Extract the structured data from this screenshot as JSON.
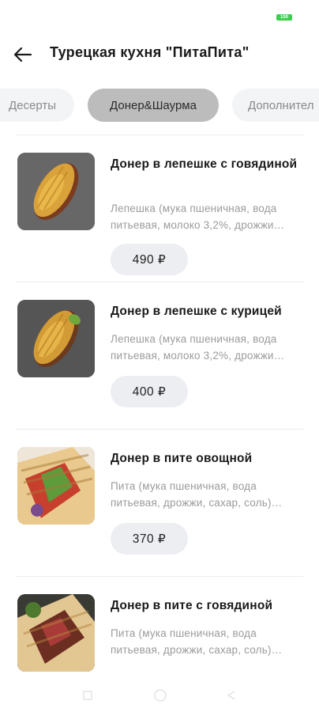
{
  "status": {
    "battery": "100"
  },
  "header": {
    "title": "Турецкая кухня \"ПитаПита\""
  },
  "tabs": [
    {
      "label": "Десерты"
    },
    {
      "label": "Донер&Шаурма"
    },
    {
      "label": "Дополнител"
    }
  ],
  "items": [
    {
      "title": "Донер в лепешке с говядиной",
      "desc": "Лепешка (мука пшеничная, вода питьевая, молоко 3,2%, дрожжи…",
      "price": "490 ₽"
    },
    {
      "title": "Донер в лепешке с курицей",
      "desc": "Лепешка (мука пшеничная, вода питьевая, молоко 3,2%, дрожжи…",
      "price": "400 ₽"
    },
    {
      "title": "Донер в пите овощной",
      "desc": "Пита (мука пшеничная, вода питьевая, дрожжи, сахар, соль)…",
      "price": "370 ₽"
    },
    {
      "title": "Донер в пите с говядиной",
      "desc": "Пита (мука пшеничная, вода питьевая, дрожжи, сахар, соль)…"
    }
  ],
  "colors": {
    "accent_active_tab": "#bcbcbc",
    "price_bg": "#eceef1",
    "muted_text": "#9b9b9b",
    "battery": "#3ccf4e"
  }
}
